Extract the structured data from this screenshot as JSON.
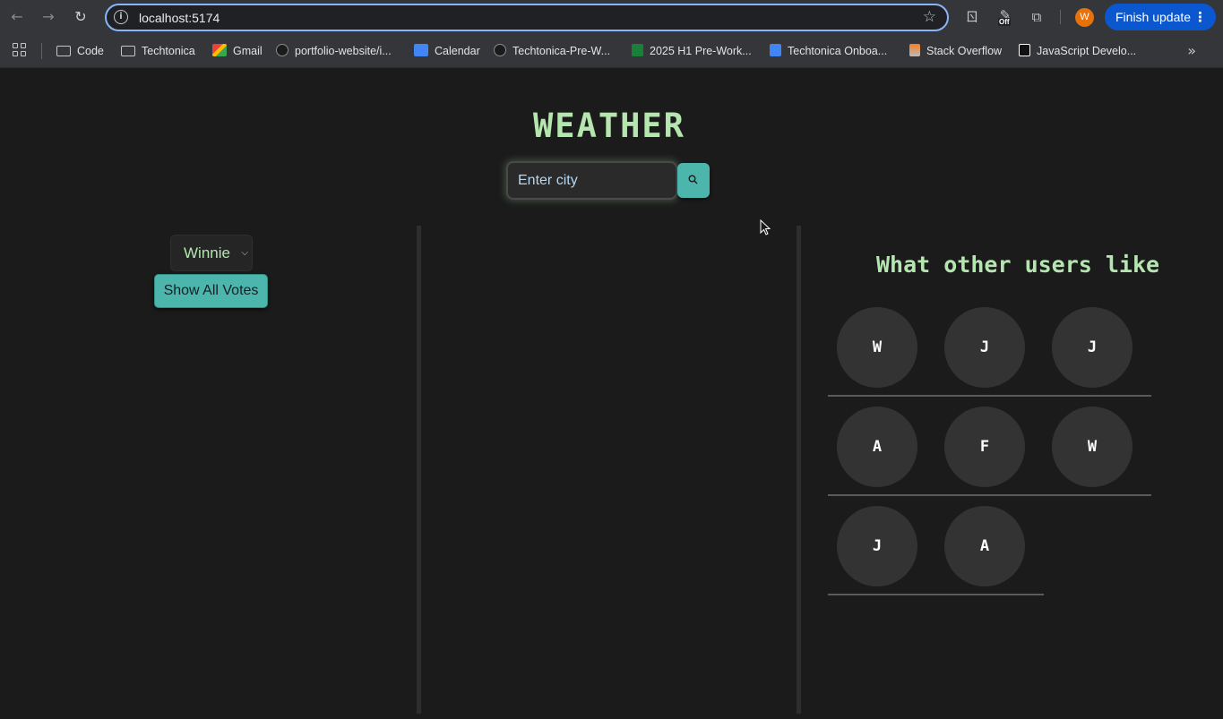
{
  "browser": {
    "url": "localhost:5174",
    "finish_update_label": "Finish update",
    "avatar_letter": "W",
    "off_badge": "Off",
    "bookmarks": [
      {
        "label": "Code",
        "icon": "folder-icon"
      },
      {
        "label": "Techtonica",
        "icon": "folder-icon"
      },
      {
        "label": "Gmail",
        "icon": "gmail-icon"
      },
      {
        "label": "portfolio-website/i...",
        "icon": "github-icon"
      },
      {
        "label": "Calendar",
        "icon": "calendar-icon"
      },
      {
        "label": "Techtonica-Pre-W...",
        "icon": "github-icon"
      },
      {
        "label": "2025 H1 Pre-Work...",
        "icon": "sheets-icon"
      },
      {
        "label": "Techtonica Onboa...",
        "icon": "docs-icon"
      },
      {
        "label": "Stack Overflow",
        "icon": "stackoverflow-icon"
      },
      {
        "label": "JavaScript Develo...",
        "icon": "js-icon"
      }
    ]
  },
  "app": {
    "title": "WEATHER",
    "search": {
      "placeholder": "Enter city"
    },
    "user_select": {
      "selected": "Winnie"
    },
    "show_votes_label": "Show All Votes",
    "users_panel": {
      "title": "What other users like",
      "users": [
        "W",
        "J",
        "J",
        "A",
        "F",
        "W",
        "J",
        "A"
      ]
    }
  },
  "colors": {
    "accent_teal": "#4db6ac",
    "title_green": "#b5e6b0",
    "background": "#1b1b1b"
  }
}
